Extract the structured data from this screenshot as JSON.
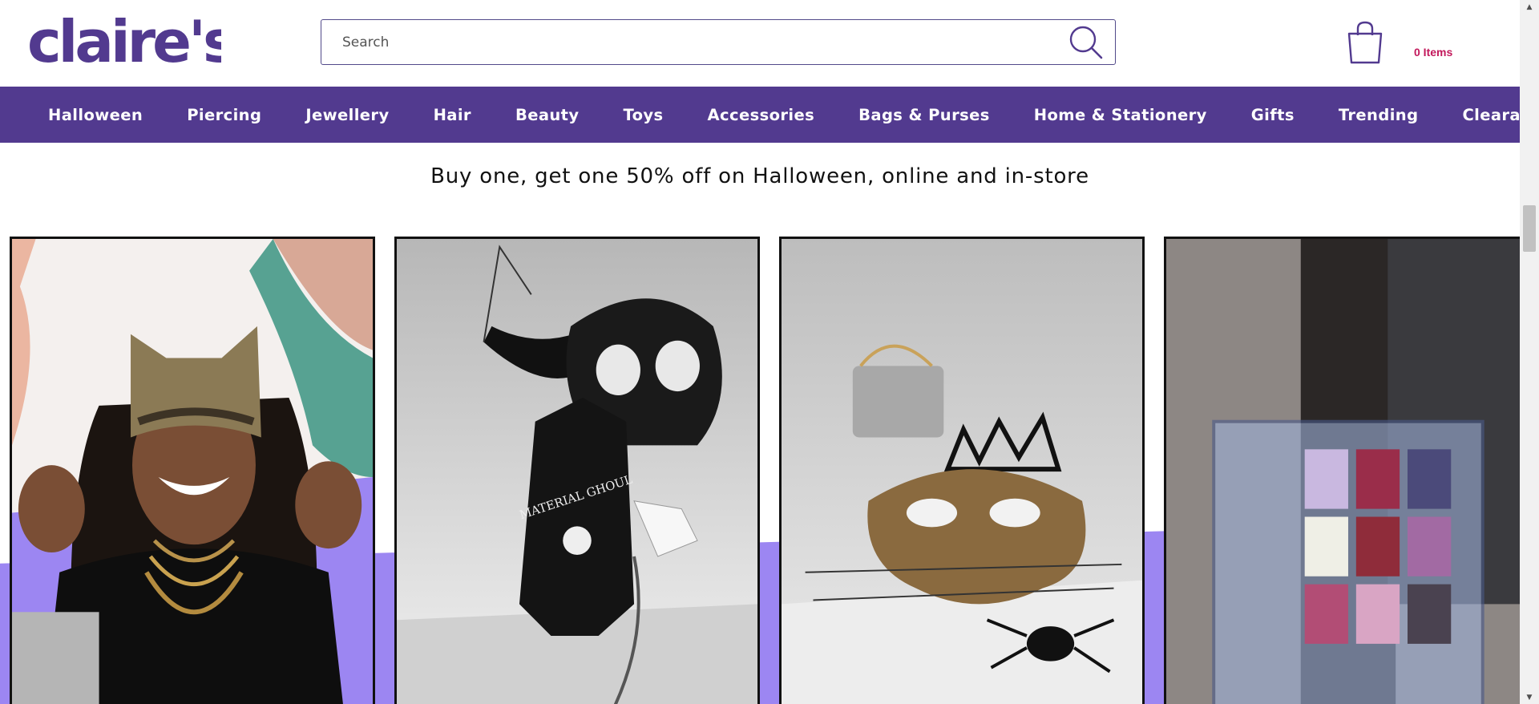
{
  "brand": {
    "name": "claire's",
    "color": "#523a8f"
  },
  "search": {
    "placeholder": "Search",
    "value": "",
    "icon": "search-icon"
  },
  "cart": {
    "icon": "shopping-bag-icon",
    "count_label": "0 Items",
    "label_color": "#c2185b"
  },
  "nav": {
    "background": "#523a8f",
    "items": [
      {
        "label": "Halloween"
      },
      {
        "label": "Piercing"
      },
      {
        "label": "Jewellery"
      },
      {
        "label": "Hair"
      },
      {
        "label": "Beauty"
      },
      {
        "label": "Toys"
      },
      {
        "label": "Accessories"
      },
      {
        "label": "Bags & Purses"
      },
      {
        "label": "Home & Stationery"
      },
      {
        "label": "Gifts"
      },
      {
        "label": "Trending"
      },
      {
        "label": "Clearance"
      }
    ]
  },
  "promo": {
    "text": "Buy one, get one 50% off on Halloween, online and in-store"
  },
  "tiles": [
    {
      "name": "model-cat-mask-image",
      "coffin_bag_text": ""
    },
    {
      "name": "skull-mask-coffin-bag-image",
      "coffin_bag_text": "MATERIAL GHOUL"
    },
    {
      "name": "leopard-mask-crown-bag-image",
      "coffin_bag_text": ""
    },
    {
      "name": "eyeshadow-palette-image",
      "coffin_bag_text": ""
    }
  ],
  "accent_colors": {
    "lilac": "#9c86f2",
    "border": "#111111"
  }
}
